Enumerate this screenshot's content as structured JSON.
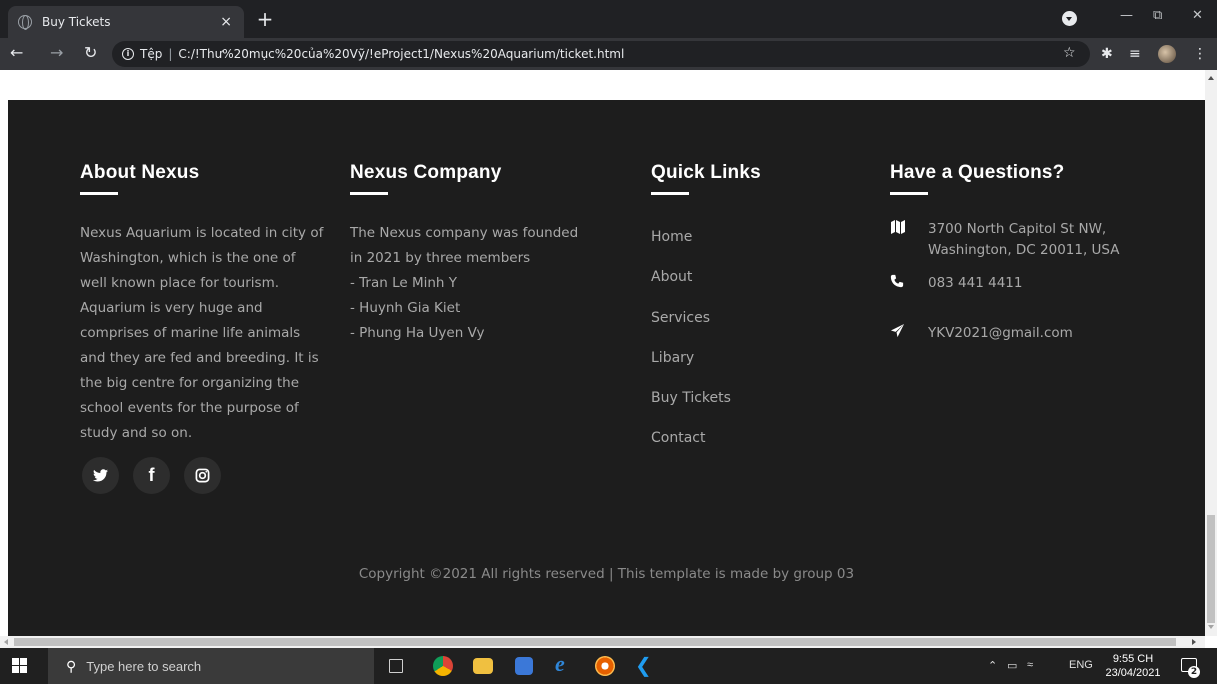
{
  "browser": {
    "tab_title": "Buy Tickets",
    "tab_close": "×",
    "new_tab": "+",
    "address_scheme": "Tệp",
    "address_separator": "|",
    "address_url": "C:/!Thư%20mục%20của%20Vỹ/!eProject1/Nexus%20Aquarium/ticket.html"
  },
  "footer": {
    "about": {
      "title": "About Nexus",
      "text": "Nexus Aquarium is located in city of Washington, which is the one of well known place for tourism. Aquarium is very huge and comprises of marine life animals and they are fed and breeding. It is the big centre for organizing the school events for the purpose of study and so on."
    },
    "company": {
      "title": "Nexus Company",
      "lines": [
        "The Nexus company was founded",
        "in 2021 by three members",
        "- Tran Le Minh Y",
        "- Huynh Gia Kiet",
        "- Phung Ha Uyen Vy"
      ]
    },
    "links": {
      "title": "Quick Links",
      "items": [
        "Home",
        "About",
        "Services",
        "Libary",
        "Buy Tickets",
        "Contact"
      ]
    },
    "contact": {
      "title": "Have a Questions?",
      "address_line1": "3700 North Capitol St NW,",
      "address_line2": "Washington, DC 20011, USA",
      "phone": "083 441 4411",
      "email": "YKV2021@gmail.com"
    },
    "social": [
      {
        "icon": "twitter-icon"
      },
      {
        "icon": "facebook-icon"
      },
      {
        "icon": "instagram-icon"
      }
    ],
    "copyright": "Copyright ©2021 All rights reserved | This template is made by group 03"
  },
  "taskbar": {
    "search_placeholder": "Type here to search",
    "language": "ENG",
    "time": "9:55 CH",
    "date": "23/04/2021",
    "notification_count": "2"
  }
}
